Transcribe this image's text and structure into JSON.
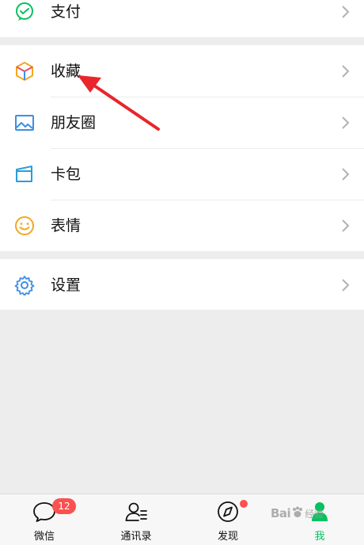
{
  "menu": {
    "pay": {
      "label": "支付",
      "icon": "wechat-pay-icon"
    },
    "favorites": {
      "label": "收藏",
      "icon": "favorites-cube-icon"
    },
    "moments": {
      "label": "朋友圈",
      "icon": "moments-picture-icon"
    },
    "cards": {
      "label": "卡包",
      "icon": "card-wallet-icon"
    },
    "stickers": {
      "label": "表情",
      "icon": "smiley-icon"
    },
    "settings": {
      "label": "设置",
      "icon": "gear-icon"
    }
  },
  "tabbar": {
    "chats": {
      "label": "微信",
      "badge": "12"
    },
    "contacts": {
      "label": "通讯录"
    },
    "discover": {
      "label": "发现"
    },
    "me": {
      "label": "我"
    }
  },
  "watermark": {
    "text": "Bai",
    "sub": "经验"
  },
  "colors": {
    "accent": "#07c160",
    "badge": "#fa5151",
    "annotation_arrow": "#e8262b",
    "background": "#ededed"
  }
}
